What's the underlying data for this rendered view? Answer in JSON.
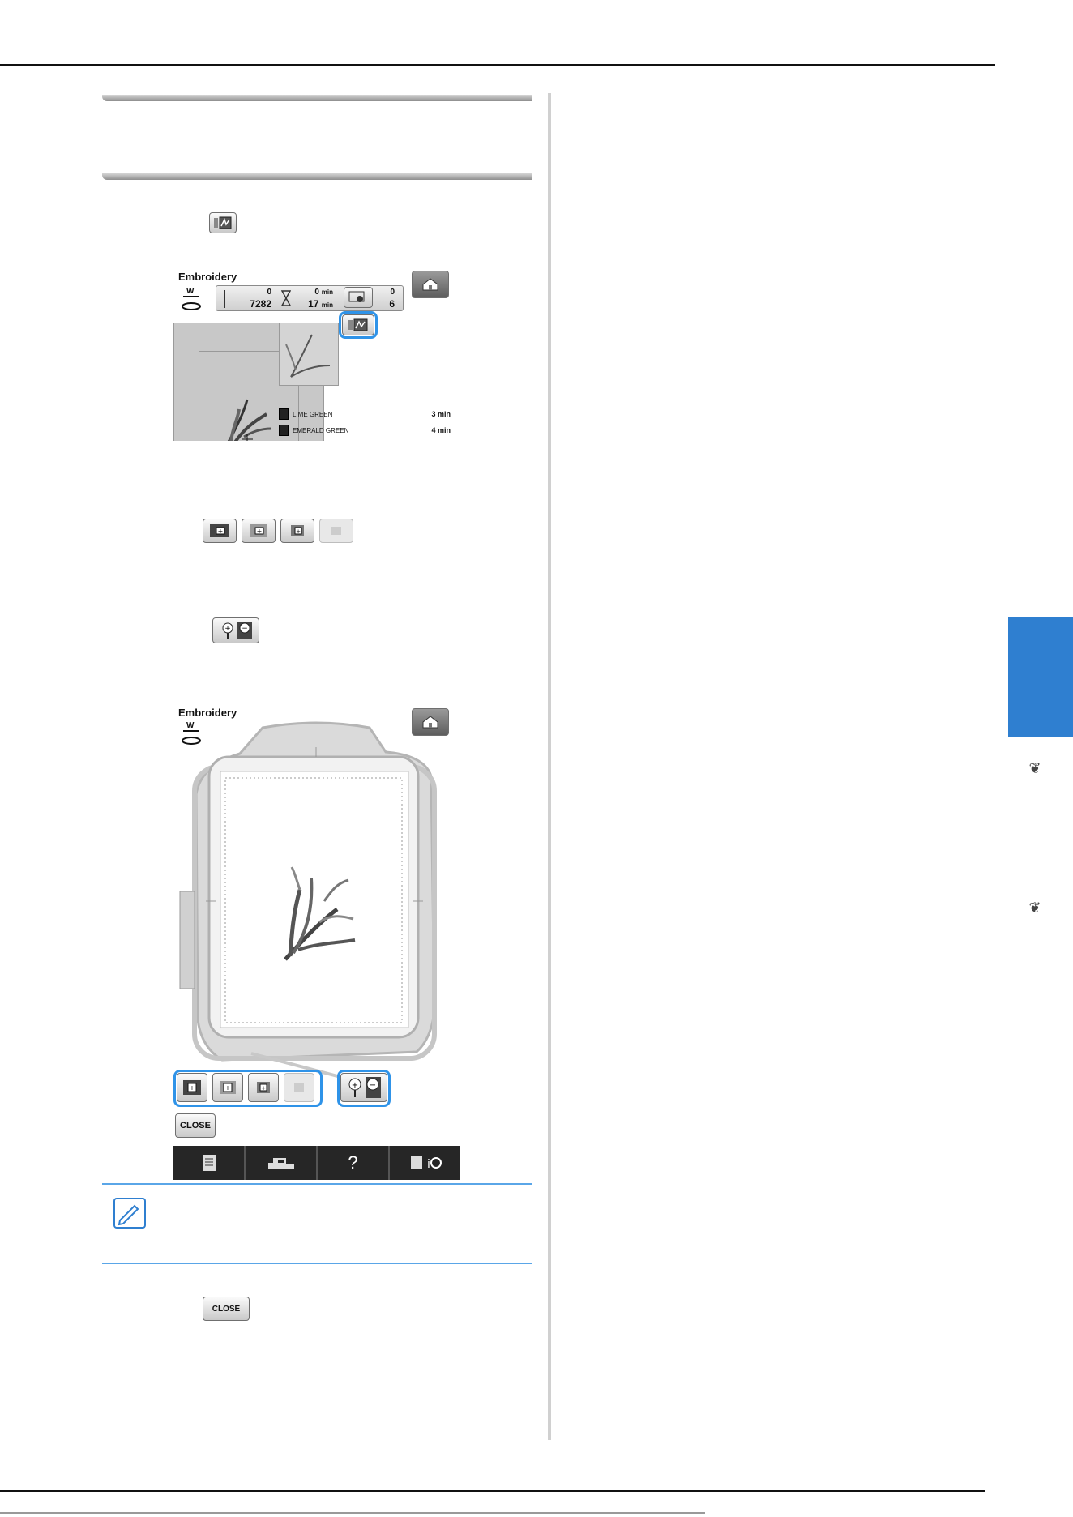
{
  "screen1": {
    "title": "Embroidery",
    "needle_label": "W",
    "stitch_current": "0",
    "stitch_total": "7282",
    "time_current": "0",
    "time_current_unit": "min",
    "time_total": "17",
    "time_total_unit": "min",
    "color_current": "0",
    "color_total": "6",
    "threads": [
      {
        "name": "LIME GREEN",
        "time": "3 min"
      },
      {
        "name": "EMERALD GREEN",
        "time": "4 min"
      }
    ]
  },
  "screen2": {
    "title": "Embroidery",
    "needle_label": "W",
    "close_label": "CLOSE",
    "help_label": "?"
  },
  "inline_close_label": "CLOSE",
  "colors": {
    "accent_blue": "#2f7fd0",
    "highlight_blue": "#2f93e8",
    "nav_bar": "#262626"
  }
}
